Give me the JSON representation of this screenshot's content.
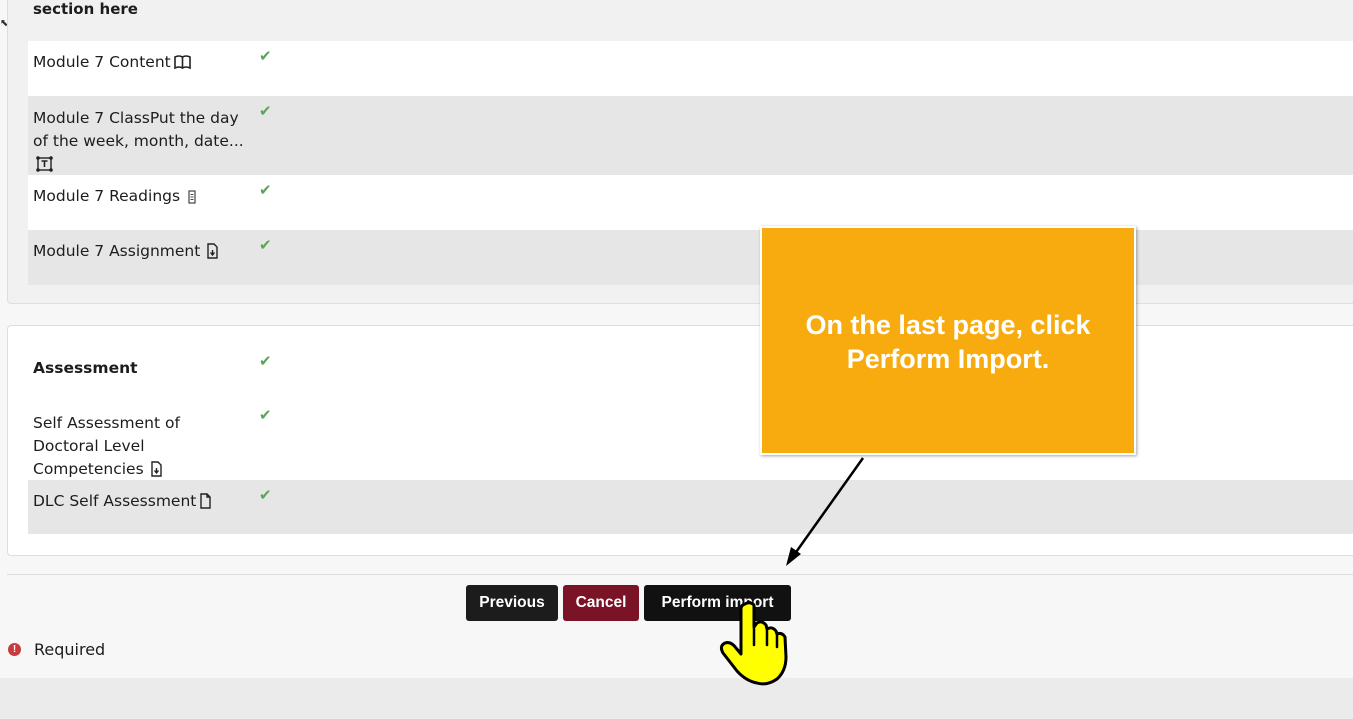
{
  "content_panel": {
    "section_title": "section here",
    "items": [
      {
        "label": "Module 7 Content",
        "icon": "book-icon",
        "status": "✔"
      },
      {
        "label": "Module 7 ClassPut the day of the week, month, date...",
        "icon": "text-frame-icon",
        "status": "✔"
      },
      {
        "label": "Module 7 Readings",
        "icon": "file-list-icon",
        "status": "✔"
      },
      {
        "label": "Module 7 Assignment",
        "icon": "upload-document-icon",
        "status": "✔"
      }
    ]
  },
  "assessment_panel": {
    "title": "Assessment",
    "title_status": "✔",
    "items": [
      {
        "label": "Self Assessment of Doctoral Level Competencies",
        "icon": "upload-document-icon",
        "status": "✔"
      },
      {
        "label": "DLC Self Assessment",
        "icon": "document-icon",
        "status": "✔"
      }
    ]
  },
  "buttons": {
    "previous": "Previous",
    "cancel": "Cancel",
    "perform_import": "Perform import"
  },
  "required_note": {
    "icon_glyph": "!",
    "text": "Required"
  },
  "callout": {
    "text": "On the last page, click Perform Import."
  },
  "colors": {
    "check": "#5aa35a",
    "cancel_button": "#7a1326",
    "dark_button": "#1c1c1c",
    "callout": "#f7ab0f",
    "required_icon": "#c63c3c",
    "pointer_hand": "#ffff00"
  }
}
